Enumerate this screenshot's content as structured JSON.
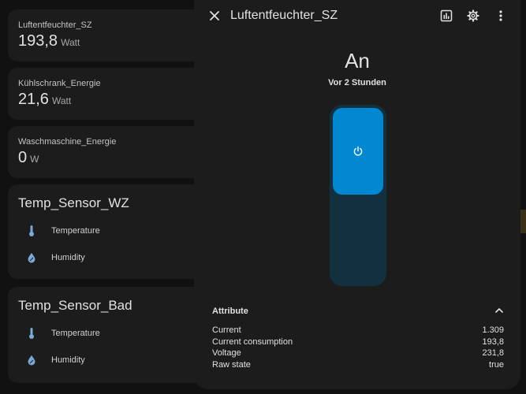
{
  "cards": {
    "sensors": [
      {
        "name": "Luftentfeuchter_SZ",
        "value": "193,8",
        "unit": "Watt"
      },
      {
        "name": "Kühlschrank_Energie",
        "value": "21,6",
        "unit": "Watt"
      },
      {
        "name": "Waschmaschine_Energie",
        "value": "0",
        "unit": "W"
      }
    ],
    "temp_sensors": [
      {
        "title": "Temp_Sensor_WZ",
        "rows": [
          {
            "label": "Temperature",
            "icon": "thermometer-icon"
          },
          {
            "label": "Humidity",
            "icon": "water-percent-icon"
          }
        ]
      },
      {
        "title": "Temp_Sensor_Bad",
        "rows": [
          {
            "label": "Temperature",
            "icon": "thermometer-icon"
          },
          {
            "label": "Humidity",
            "icon": "water-percent-icon"
          }
        ]
      }
    ]
  },
  "dialog": {
    "title": "Luftentfeuchter_SZ",
    "state": "An",
    "last_changed": "Vor 2 Stunden",
    "attributes_title": "Attribute",
    "attributes": [
      {
        "name": "Current",
        "value": "1.309"
      },
      {
        "name": "Current consumption",
        "value": "193,8"
      },
      {
        "name": "Voltage",
        "value": "231,8"
      },
      {
        "name": "Raw state",
        "value": "true"
      }
    ]
  },
  "colors": {
    "accent": "#0288d1",
    "toggle_track": "#12303e",
    "card_bg": "#1c1c1c",
    "page_bg": "#111111",
    "icon": "#7aa9d6"
  }
}
